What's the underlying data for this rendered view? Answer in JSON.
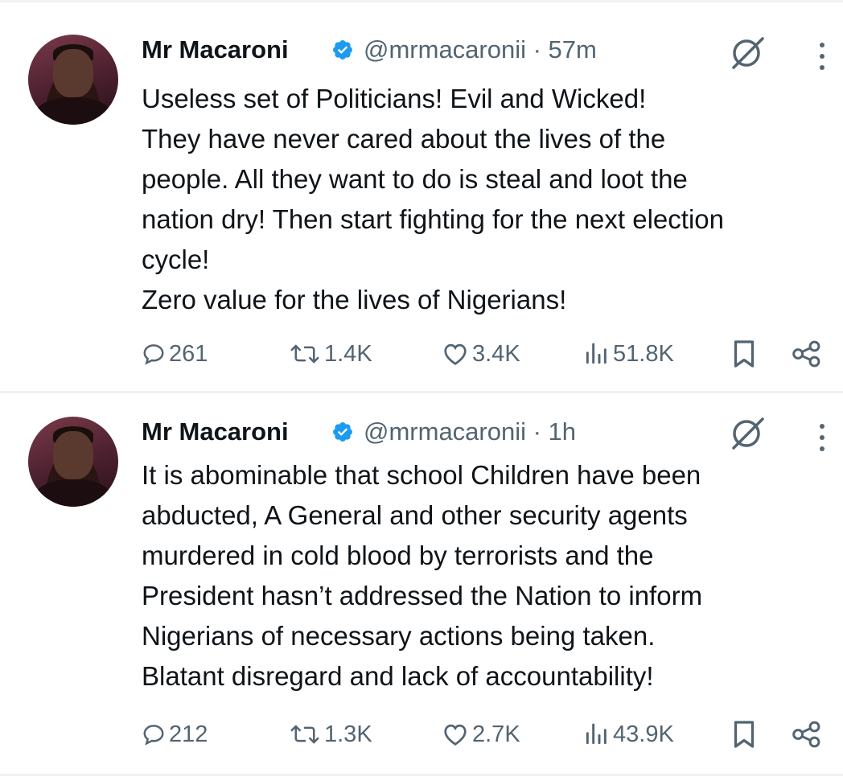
{
  "tweets": [
    {
      "author_name": "Mr Macaroni",
      "handle_time": "@mrmacaronii · 57m",
      "lines": [
        "Useless set of Politicians! Evil and Wicked!",
        "They have never cared about the lives of the",
        "people. All they want to do is steal and loot the",
        "nation dry! Then start fighting for the next election",
        "cycle!",
        "Zero value for the lives of Nigerians!"
      ],
      "replies": "261",
      "reposts": "1.4K",
      "likes": "3.4K",
      "views": "51.8K"
    },
    {
      "author_name": "Mr Macaroni",
      "handle_time": "@mrmacaronii · 1h",
      "lines": [
        "It is abominable that school Children have been",
        "abducted, A General and other security agents",
        "murdered in cold blood by terrorists and the",
        "President hasn’t addressed the Nation to inform",
        "Nigerians of necessary actions being taken.",
        "Blatant disregard and lack of accountability!"
      ],
      "replies": "212",
      "reposts": "1.3K",
      "likes": "2.7K",
      "views": "43.9K"
    }
  ],
  "colors": {
    "text": "#0f1419",
    "muted": "#536471",
    "verified": "#1d9bf0",
    "divider": "#eff3f4"
  },
  "icons": [
    "verified-badge-icon",
    "grok-icon",
    "more-icon",
    "reply-icon",
    "repost-icon",
    "like-icon",
    "views-icon",
    "bookmark-icon",
    "share-icon"
  ]
}
